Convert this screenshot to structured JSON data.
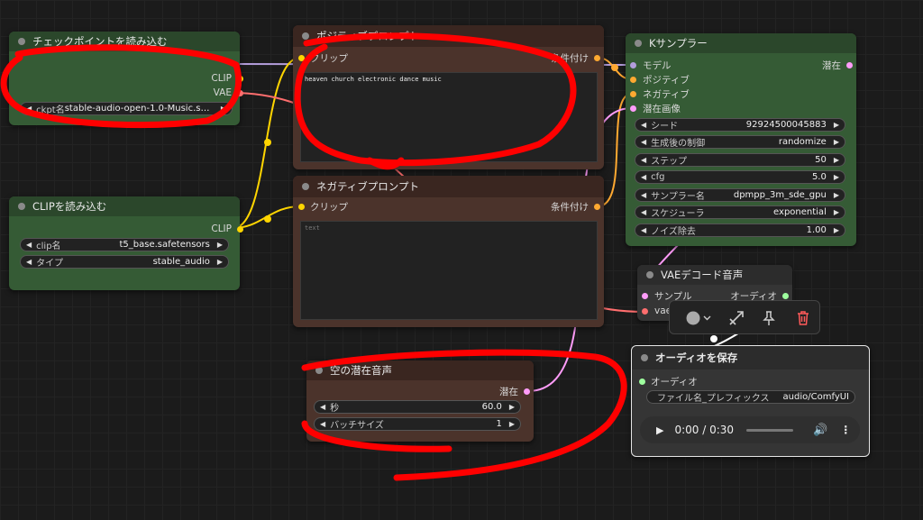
{
  "colors": {
    "canvas_bg": "#1b1b1b",
    "green_node": "#355b35",
    "brown_node": "#4b332b",
    "gray_node": "#353535",
    "model_wire": "#b39ddb",
    "clip_wire": "#ffd500",
    "vae_wire": "#ff6e6e",
    "conditioning_wire": "#ffa931",
    "latent_wire": "#ff9cf9",
    "audio_wire": "#9eff9e",
    "annotation_red": "#ff0000"
  },
  "checkpoint_node": {
    "title": "チェックポイントを読み込む",
    "outputs": [
      "CLIP",
      "VAE"
    ],
    "widget_label": "ckpt名",
    "widget_value": "stable-audio-open-1.0-Music.safe..."
  },
  "clip_loader_node": {
    "title": "CLIPを読み込む",
    "output": "CLIP",
    "widgets": [
      {
        "label": "clip名",
        "value": "t5_base.safetensors"
      },
      {
        "label": "タイプ",
        "value": "stable_audio"
      }
    ]
  },
  "positive_node": {
    "title": "ポジティブプロンプト",
    "input": "クリップ",
    "output": "条件付け",
    "text": "heaven church electronic dance music"
  },
  "negative_node": {
    "title": "ネガティブプロンプト",
    "input": "クリップ",
    "output": "条件付け",
    "placeholder": "text"
  },
  "ksampler_node": {
    "title": "Kサンプラー",
    "inputs": [
      "モデル",
      "ポジティブ",
      "ネガティブ",
      "潜在画像"
    ],
    "output": "潜在",
    "widgets": [
      {
        "label": "シード",
        "value": "92924500045883"
      },
      {
        "label": "生成後の制御",
        "value": "randomize"
      },
      {
        "label": "ステップ",
        "value": "50"
      },
      {
        "label": "cfg",
        "value": "5.0"
      },
      {
        "label": "サンプラー名",
        "value": "dpmpp_3m_sde_gpu"
      },
      {
        "label": "スケジューラ",
        "value": "exponential"
      },
      {
        "label": "ノイズ除去",
        "value": "1.00"
      }
    ]
  },
  "empty_latent_node": {
    "title": "空の潜在音声",
    "output": "潜在",
    "widgets": [
      {
        "label": "秒",
        "value": "60.0"
      },
      {
        "label": "バッチサイズ",
        "value": "1"
      }
    ]
  },
  "vae_decode_node": {
    "title": "VAEデコード音声",
    "inputs": [
      "サンプル",
      "vae"
    ],
    "output": "オーディオ"
  },
  "save_audio_node": {
    "title": "オーディオを保存",
    "input": "オーディオ",
    "widget_label": "ファイル名_プレフィックス",
    "widget_value": "audio/ComfyUI",
    "player_time": "0:00 / 0:30",
    "progress_fraction": 0.0
  },
  "selection_toolbar": {
    "icons": [
      "color-circle-icon",
      "chevron-down-icon",
      "bypass-icon",
      "pin-icon",
      "trash-icon"
    ]
  }
}
